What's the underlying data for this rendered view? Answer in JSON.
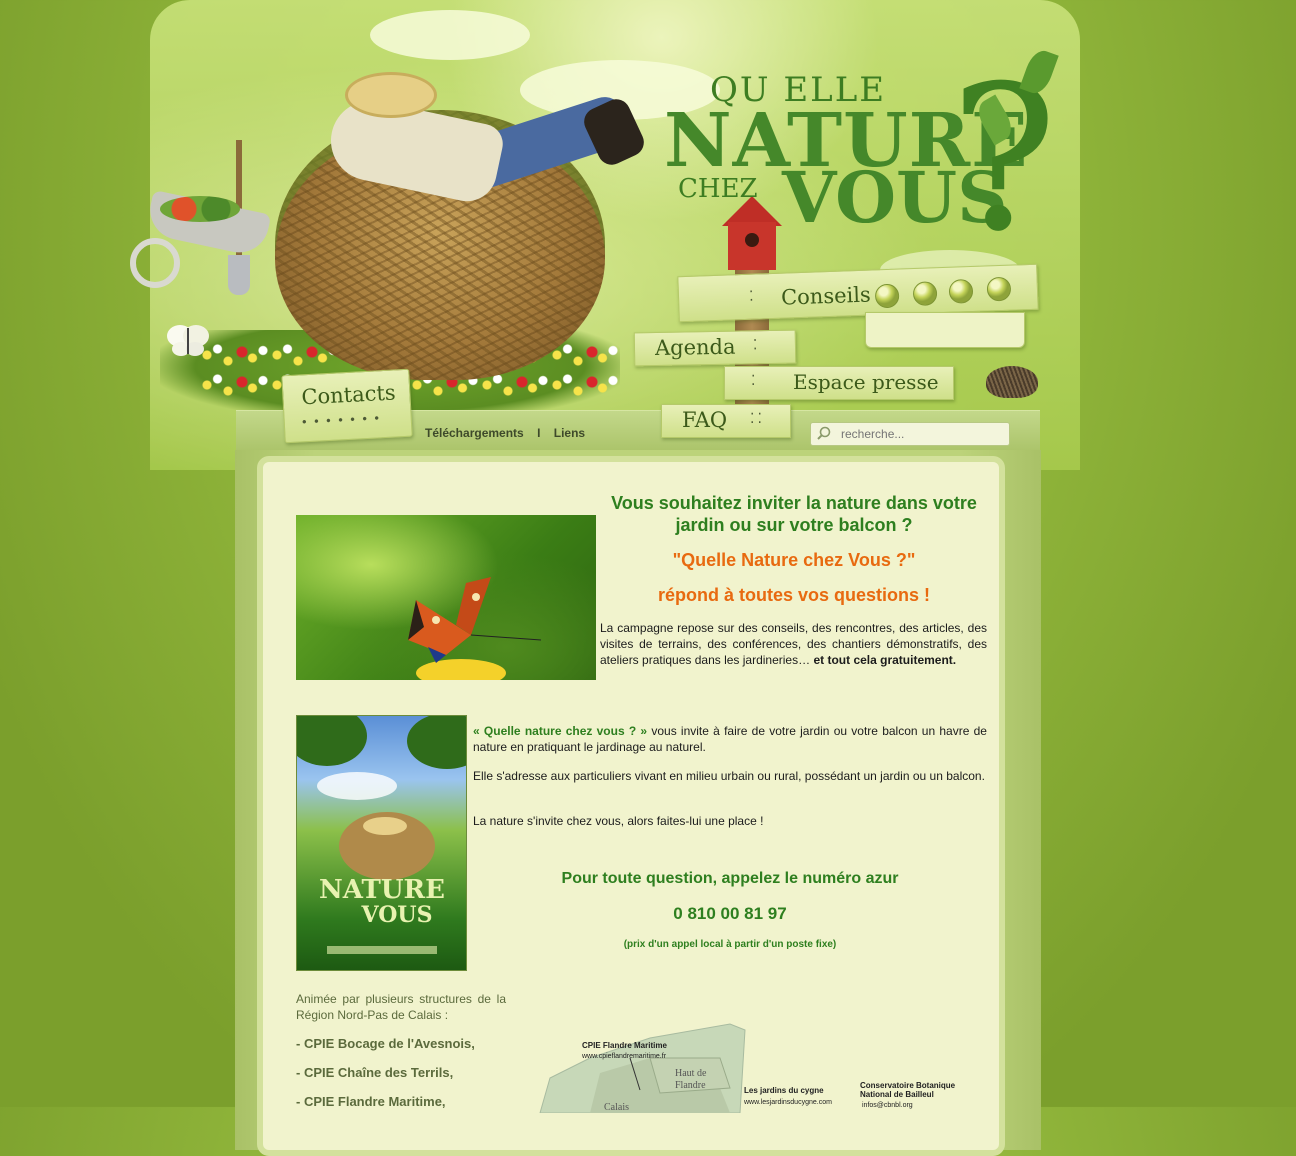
{
  "logo": {
    "line1": "QU ELLE",
    "line2": "NATURE",
    "line3": "CHEZ",
    "line4": "VOUS",
    "question_mark": "?"
  },
  "nav": {
    "conseils": "Conseils",
    "agenda": "Agenda",
    "espace_presse": "Espace presse",
    "contacts": "Contacts",
    "faq": "FAQ"
  },
  "top_links": {
    "telechargements": "Téléchargements",
    "separator": "I",
    "liens": "Liens"
  },
  "search": {
    "placeholder": "recherche..."
  },
  "intro": {
    "heading": "Vous souhaitez inviter la nature dans votre jardin ou sur votre balcon ?",
    "campaign_name": "\"Quelle Nature chez Vous ?\"",
    "tagline": "répond à toutes vos questions !",
    "paragraph": "La campagne repose sur des conseils, des rencontres, des articles, des visites de terrains, des conférences, des chantiers démonstratifs, des ateliers pratiques dans les jardineries…",
    "paragraph_bold": "et tout cela gratuitement."
  },
  "about": {
    "lead_green": "« Quelle nature chez vous ? »",
    "p1": "vous invite à faire de votre jardin ou votre balcon un havre de nature en pratiquant le jardinage au naturel.",
    "p2": "Elle s'adresse aux particuliers vivant en milieu urbain ou rural, possédant un jardin ou un balcon.",
    "p3": "La nature s'invite chez vous, alors faites-lui une place !"
  },
  "contact_box": {
    "question": "Pour toute question, appelez le numéro azur",
    "phone": "0 810 00 81 97",
    "note": "(prix d'un appel local à partir d'un poste fixe)"
  },
  "partners": {
    "intro": "Animée par plusieurs structures de la Région Nord-Pas de Calais :",
    "items": [
      "- CPIE Bocage de l'Avesnois,",
      "- CPIE Chaîne des Terrils,",
      "- CPIE Flandre Maritime,"
    ]
  },
  "map_labels": {
    "cpie_flandre": "CPIE Flandre Maritime",
    "cpie_flandre_url": "www.cpieflandremaritime.fr",
    "haut_de_flandre_1": "Haut de",
    "haut_de_flandre_2": "Flandre",
    "jardins": "Les jardins du cygne",
    "jardins_url": "www.lesjardinsducygne.com",
    "conservatoire_1": "Conservatoire Botanique",
    "conservatoire_2": "National de Bailleul",
    "conservatoire_mail": "infos@cbnbl.org",
    "calais": "Calais"
  },
  "colors": {
    "accent_green": "#2e7f1f",
    "accent_orange": "#e86a10",
    "content_bg": "#f1f3cd",
    "page_bg": "#8fb43a"
  }
}
